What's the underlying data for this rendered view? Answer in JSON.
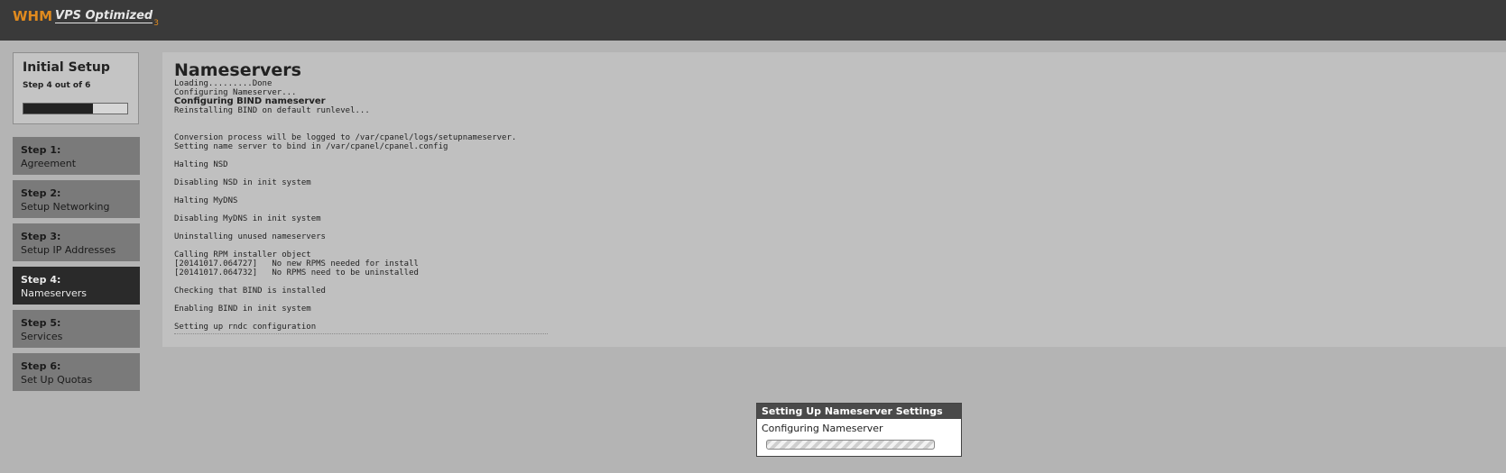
{
  "header": {
    "logo_text": "WHM",
    "logo_subtitle": "VPS Optimized",
    "logo_version": "3"
  },
  "setup": {
    "title": "Initial Setup",
    "progress_text": "Step 4 out of 6",
    "progress_fraction": 0.67
  },
  "steps": [
    {
      "num": "Step 1:",
      "name": "Agreement",
      "active": false
    },
    {
      "num": "Step 2:",
      "name": "Setup Networking",
      "active": false
    },
    {
      "num": "Step 3:",
      "name": "Setup IP Addresses",
      "active": false
    },
    {
      "num": "Step 4:",
      "name": "Nameservers",
      "active": true
    },
    {
      "num": "Step 5:",
      "name": "Services",
      "active": false
    },
    {
      "num": "Step 6:",
      "name": "Set Up Quotas",
      "active": false
    }
  ],
  "main": {
    "title": "Nameservers",
    "log": [
      {
        "text": "Loading.........Done"
      },
      {
        "text": "Configuring Nameserver..."
      },
      {
        "text": "Configuring BIND nameserver",
        "bold": true
      },
      {
        "text": "Reinstalling BIND on default runlevel..."
      },
      {
        "text": ""
      },
      {
        "text": ""
      },
      {
        "text": "Conversion process will be logged to /var/cpanel/logs/setupnameserver."
      },
      {
        "text": "Setting name server to bind in /var/cpanel/cpanel.config"
      },
      {
        "text": ""
      },
      {
        "text": "Halting NSD"
      },
      {
        "text": ""
      },
      {
        "text": "Disabling NSD in init system"
      },
      {
        "text": ""
      },
      {
        "text": "Halting MyDNS"
      },
      {
        "text": ""
      },
      {
        "text": "Disabling MyDNS in init system"
      },
      {
        "text": ""
      },
      {
        "text": "Uninstalling unused nameservers"
      },
      {
        "text": ""
      },
      {
        "text": "Calling RPM installer object"
      },
      {
        "text": "[20141017.064727]   No new RPMS needed for install"
      },
      {
        "text": "[20141017.064732]   No RPMS need to be uninstalled"
      },
      {
        "text": ""
      },
      {
        "text": "Checking that BIND is installed"
      },
      {
        "text": ""
      },
      {
        "text": "Enabling BIND in init system"
      },
      {
        "text": ""
      },
      {
        "text": "Setting up rndc configuration"
      }
    ]
  },
  "popup": {
    "title": "Setting Up Nameserver Settings",
    "text": "Configuring Nameserver"
  },
  "colors": {
    "brand": "#e08a1e",
    "active_step": "#2a2a2a",
    "inactive_step": "#7a7a7a"
  }
}
